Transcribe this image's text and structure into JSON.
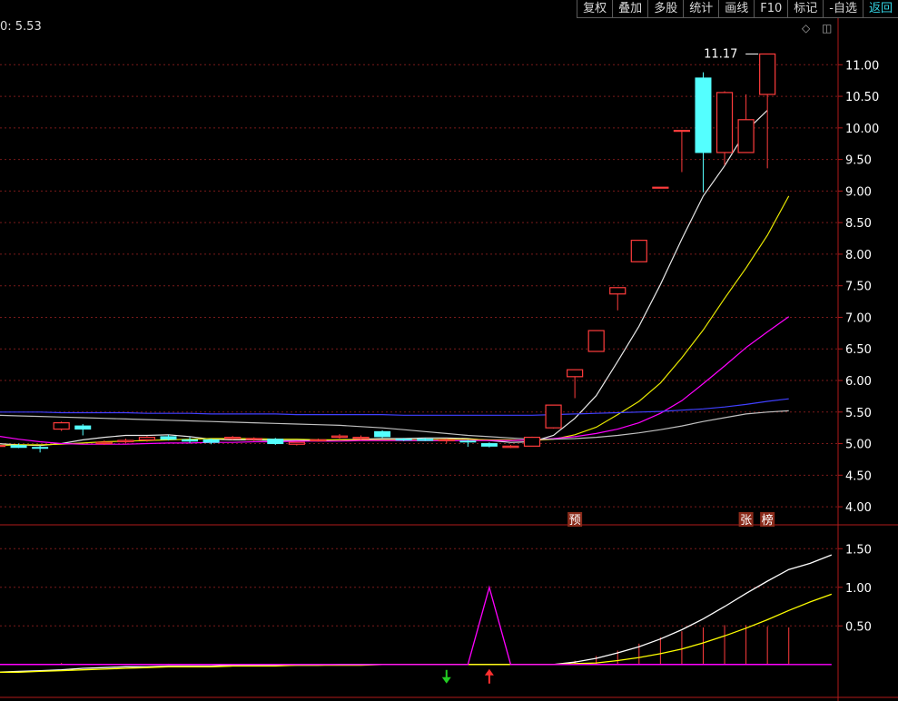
{
  "toolbar": {
    "buttons": [
      "复权",
      "叠加",
      "多股",
      "统计",
      "画线",
      "F10",
      "标记",
      "-自选",
      "返回"
    ],
    "active_index": 8
  },
  "readout": "0: 5.53",
  "icons": {
    "diamond": "◇",
    "window": "◫"
  },
  "colors": {
    "bg": "#000000",
    "up": "#ff3c3c",
    "down": "#54ffff",
    "grid": "#7a1a1a",
    "axis": "#b01a1a",
    "axis_text": "#ffffff",
    "ma5": "#e8e8e8",
    "ma10": "#e8e800",
    "ma20": "#ff00ff",
    "ma60": "#4040ff",
    "ma_long": "#c0c0c0",
    "macd_dif": "#ffffff",
    "macd_dea": "#ffff00",
    "signal_line": "#ff00ff",
    "arrow_down": "#22cc22",
    "arrow_up": "#ff3030"
  },
  "chart_data": [
    {
      "type": "candlestick",
      "ylim": [
        3.8,
        11.45
      ],
      "yticks": [
        4.0,
        4.5,
        5.0,
        5.5,
        6.0,
        6.5,
        7.0,
        7.5,
        8.0,
        8.5,
        9.0,
        9.5,
        10.0,
        10.5,
        11.0
      ],
      "max_label": "11.17",
      "candles": [
        {
          "o": 4.96,
          "h": 4.99,
          "l": 4.92,
          "c": 4.97
        },
        {
          "o": 4.97,
          "h": 5.0,
          "l": 4.93,
          "c": 4.94
        },
        {
          "o": 4.94,
          "h": 4.97,
          "l": 4.86,
          "c": 4.93
        },
        {
          "o": 5.23,
          "h": 5.35,
          "l": 5.2,
          "c": 5.33
        },
        {
          "o": 5.28,
          "h": 5.31,
          "l": 5.13,
          "c": 5.23
        },
        {
          "o": 5.0,
          "h": 5.05,
          "l": 4.98,
          "c": 5.02
        },
        {
          "o": 5.03,
          "h": 5.08,
          "l": 5.0,
          "c": 5.05
        },
        {
          "o": 5.06,
          "h": 5.12,
          "l": 5.03,
          "c": 5.1
        },
        {
          "o": 5.11,
          "h": 5.14,
          "l": 5.05,
          "c": 5.07
        },
        {
          "o": 5.06,
          "h": 5.1,
          "l": 5.01,
          "c": 5.04
        },
        {
          "o": 5.06,
          "h": 5.08,
          "l": 4.99,
          "c": 5.02
        },
        {
          "o": 5.08,
          "h": 5.12,
          "l": 5.06,
          "c": 5.1
        },
        {
          "o": 5.07,
          "h": 5.1,
          "l": 5.04,
          "c": 5.08
        },
        {
          "o": 5.07,
          "h": 5.09,
          "l": 4.98,
          "c": 5.0
        },
        {
          "o": 4.99,
          "h": 5.03,
          "l": 4.97,
          "c": 5.02
        },
        {
          "o": 5.05,
          "h": 5.08,
          "l": 5.03,
          "c": 5.06
        },
        {
          "o": 5.1,
          "h": 5.15,
          "l": 5.08,
          "c": 5.12
        },
        {
          "o": 5.08,
          "h": 5.13,
          "l": 5.06,
          "c": 5.1
        },
        {
          "o": 5.19,
          "h": 5.21,
          "l": 5.09,
          "c": 5.11
        },
        {
          "o": 5.07,
          "h": 5.09,
          "l": 5.04,
          "c": 5.06
        },
        {
          "o": 5.07,
          "h": 5.09,
          "l": 5.04,
          "c": 5.05
        },
        {
          "o": 5.05,
          "h": 5.08,
          "l": 5.0,
          "c": 5.06
        },
        {
          "o": 5.04,
          "h": 5.06,
          "l": 4.95,
          "c": 5.03
        },
        {
          "o": 5.0,
          "h": 5.02,
          "l": 4.94,
          "c": 4.96
        },
        {
          "o": 4.94,
          "h": 4.98,
          "l": 4.93,
          "c": 4.96
        },
        {
          "o": 4.96,
          "h": 5.11,
          "l": 4.96,
          "c": 5.1
        },
        {
          "o": 5.25,
          "h": 5.61,
          "l": 5.24,
          "c": 5.61
        },
        {
          "o": 6.06,
          "h": 6.17,
          "l": 5.72,
          "c": 6.17
        },
        {
          "o": 6.46,
          "h": 6.79,
          "l": 6.46,
          "c": 6.79
        },
        {
          "o": 7.37,
          "h": 7.47,
          "l": 7.11,
          "c": 7.47
        },
        {
          "o": 7.88,
          "h": 8.22,
          "l": 7.88,
          "c": 8.22
        },
        {
          "o": 9.06,
          "h": 9.06,
          "l": 9.06,
          "c": 9.06
        },
        {
          "o": 9.96,
          "h": 9.96,
          "l": 9.3,
          "c": 9.96
        },
        {
          "o": 10.79,
          "h": 10.88,
          "l": 8.98,
          "c": 9.61
        },
        {
          "o": 9.61,
          "h": 10.58,
          "l": 9.41,
          "c": 10.56
        },
        {
          "o": 9.61,
          "h": 10.53,
          "l": 9.61,
          "c": 10.13
        },
        {
          "o": 10.53,
          "h": 11.17,
          "l": 9.36,
          "c": 11.17
        }
      ],
      "tags": [
        {
          "index": 27,
          "text": "预"
        },
        {
          "index": 35,
          "text": "张"
        },
        {
          "index": 36,
          "text": "榜"
        }
      ],
      "lines": [
        {
          "name": "MA5",
          "color_key": "ma5",
          "values": [
            5.0,
            4.98,
            4.97,
            5.0,
            5.06,
            5.1,
            5.13,
            5.13,
            5.14,
            5.11,
            5.07,
            5.06,
            5.06,
            5.05,
            5.05,
            5.05,
            5.06,
            5.07,
            5.08,
            5.08,
            5.09,
            5.09,
            5.08,
            5.05,
            5.02,
            5.03,
            5.13,
            5.4,
            5.76,
            6.3,
            6.86,
            7.52,
            8.24,
            8.92,
            9.4,
            9.95,
            10.28
          ]
        },
        {
          "name": "MA10",
          "color_key": "ma10",
          "values": [
            4.97,
            4.98,
            4.98,
            4.99,
            5.01,
            5.03,
            5.04,
            5.05,
            5.06,
            5.07,
            5.08,
            5.08,
            5.08,
            5.07,
            5.07,
            5.06,
            5.06,
            5.06,
            5.06,
            5.06,
            5.06,
            5.07,
            5.07,
            5.06,
            5.06,
            5.05,
            5.07,
            5.14,
            5.26,
            5.46,
            5.67,
            5.96,
            6.36,
            6.8,
            7.3,
            7.78,
            8.3,
            8.92
          ]
        },
        {
          "name": "MA20",
          "color_key": "ma20",
          "values": [
            5.12,
            5.07,
            5.03,
            5.0,
            4.99,
            4.99,
            4.99,
            5.0,
            5.01,
            5.01,
            5.02,
            5.02,
            5.03,
            5.03,
            5.04,
            5.04,
            5.04,
            5.05,
            5.05,
            5.05,
            5.05,
            5.05,
            5.05,
            5.05,
            5.05,
            5.06,
            5.08,
            5.11,
            5.16,
            5.23,
            5.33,
            5.48,
            5.68,
            5.95,
            6.23,
            6.52,
            6.77,
            7.01
          ]
        },
        {
          "name": "MA60",
          "color_key": "ma60",
          "values": [
            5.5,
            5.5,
            5.5,
            5.49,
            5.49,
            5.49,
            5.49,
            5.48,
            5.48,
            5.48,
            5.47,
            5.47,
            5.47,
            5.47,
            5.46,
            5.46,
            5.46,
            5.46,
            5.46,
            5.45,
            5.45,
            5.45,
            5.45,
            5.45,
            5.45,
            5.45,
            5.46,
            5.47,
            5.48,
            5.49,
            5.5,
            5.51,
            5.53,
            5.55,
            5.58,
            5.62,
            5.67,
            5.71
          ]
        },
        {
          "name": "MA_LONG",
          "color_key": "ma_long",
          "values": [
            5.45,
            5.44,
            5.43,
            5.42,
            5.41,
            5.4,
            5.39,
            5.38,
            5.37,
            5.36,
            5.35,
            5.34,
            5.33,
            5.32,
            5.31,
            5.3,
            5.29,
            5.27,
            5.25,
            5.22,
            5.19,
            5.16,
            5.13,
            5.11,
            5.09,
            5.07,
            5.07,
            5.08,
            5.1,
            5.13,
            5.17,
            5.22,
            5.28,
            5.35,
            5.41,
            5.47,
            5.5,
            5.52
          ]
        }
      ]
    },
    {
      "type": "line",
      "ylim": [
        -0.12,
        1.75
      ],
      "yticks": [
        0.5,
        1.0,
        1.5
      ],
      "series": [
        {
          "name": "DIF",
          "color_key": "macd_dif",
          "values": [
            -0.1,
            -0.09,
            -0.08,
            -0.07,
            -0.05,
            -0.04,
            -0.03,
            -0.03,
            -0.02,
            -0.02,
            -0.02,
            -0.01,
            -0.01,
            -0.01,
            -0.01,
            -0.01,
            0.0,
            0.0,
            0.0,
            0.0,
            0.0,
            0.0,
            0.0,
            0.0,
            0.0,
            0.0,
            0.0,
            0.03,
            0.08,
            0.15,
            0.23,
            0.33,
            0.45,
            0.59,
            0.75,
            0.92,
            1.08,
            1.23,
            1.31,
            1.42
          ]
        },
        {
          "name": "DEA",
          "color_key": "macd_dea",
          "values": [
            -0.1,
            -0.1,
            -0.09,
            -0.08,
            -0.07,
            -0.06,
            -0.05,
            -0.04,
            -0.03,
            -0.03,
            -0.03,
            -0.02,
            -0.02,
            -0.02,
            -0.01,
            -0.01,
            -0.01,
            -0.01,
            0.0,
            0.0,
            0.0,
            0.0,
            0.0,
            0.0,
            0.0,
            0.0,
            0.0,
            0.01,
            0.02,
            0.05,
            0.09,
            0.14,
            0.2,
            0.28,
            0.37,
            0.47,
            0.58,
            0.7,
            0.81,
            0.91
          ]
        },
        {
          "name": "SIG",
          "color_key": "signal_line",
          "values": [
            0.0,
            0.0,
            0.0,
            0.0,
            0.0,
            0.0,
            0.0,
            0.0,
            0.0,
            0.0,
            0.0,
            0.0,
            0.0,
            0.0,
            0.0,
            0.0,
            0.0,
            0.0,
            0.0,
            0.0,
            0.0,
            0.0,
            0.0,
            1.0,
            0.0,
            0.0,
            0.0,
            0.0,
            0.0,
            0.0,
            0.0,
            0.0,
            0.0,
            0.0,
            0.0,
            0.0,
            0.0,
            0.0,
            0.0,
            0.0
          ]
        }
      ],
      "bars": [
        0,
        0,
        0,
        0.02,
        0,
        0,
        0,
        0,
        0.01,
        0,
        0,
        0,
        0,
        0,
        0,
        0,
        0,
        0,
        0,
        0,
        0,
        0,
        0,
        0,
        0,
        0,
        0,
        0.05,
        0.11,
        0.18,
        0.27,
        0.35,
        0.43,
        0.48,
        0.51,
        0.51,
        0.49,
        0.48
      ],
      "arrows": [
        {
          "index": 21,
          "dir": "down"
        },
        {
          "index": 23,
          "dir": "up"
        }
      ]
    }
  ]
}
